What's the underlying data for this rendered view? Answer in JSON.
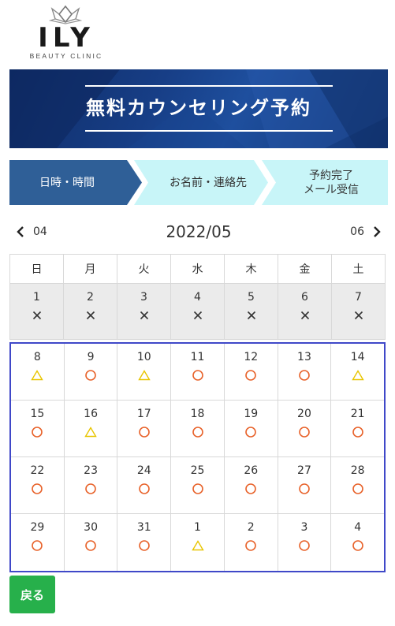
{
  "logo": {
    "brand": "ILY",
    "subtitle": "BEAUTY CLINIC"
  },
  "banner": {
    "title": "無料カウンセリング予約"
  },
  "steps": [
    {
      "label": "日時・時間",
      "active": true
    },
    {
      "label": "お名前・連絡先",
      "active": false
    },
    {
      "label_line1": "予約完了",
      "label_line2": "メール受信",
      "active": false
    }
  ],
  "month_nav": {
    "prev_label": "04",
    "current": "2022/05",
    "next_label": "06"
  },
  "calendar": {
    "weekdays": [
      "日",
      "月",
      "火",
      "水",
      "木",
      "金",
      "土"
    ],
    "weeks": [
      {
        "past": true,
        "days": [
          {
            "day": "1",
            "mark": "×"
          },
          {
            "day": "2",
            "mark": "×"
          },
          {
            "day": "3",
            "mark": "×"
          },
          {
            "day": "4",
            "mark": "×"
          },
          {
            "day": "5",
            "mark": "×"
          },
          {
            "day": "6",
            "mark": "×"
          },
          {
            "day": "7",
            "mark": "×"
          }
        ]
      },
      {
        "past": false,
        "days": [
          {
            "day": "8",
            "mark": "△"
          },
          {
            "day": "9",
            "mark": "○"
          },
          {
            "day": "10",
            "mark": "△"
          },
          {
            "day": "11",
            "mark": "○"
          },
          {
            "day": "12",
            "mark": "○"
          },
          {
            "day": "13",
            "mark": "○"
          },
          {
            "day": "14",
            "mark": "△"
          }
        ]
      },
      {
        "past": false,
        "days": [
          {
            "day": "15",
            "mark": "○"
          },
          {
            "day": "16",
            "mark": "△"
          },
          {
            "day": "17",
            "mark": "○"
          },
          {
            "day": "18",
            "mark": "○"
          },
          {
            "day": "19",
            "mark": "○"
          },
          {
            "day": "20",
            "mark": "○"
          },
          {
            "day": "21",
            "mark": "○"
          }
        ]
      },
      {
        "past": false,
        "days": [
          {
            "day": "22",
            "mark": "○"
          },
          {
            "day": "23",
            "mark": "○"
          },
          {
            "day": "24",
            "mark": "○"
          },
          {
            "day": "25",
            "mark": "○"
          },
          {
            "day": "26",
            "mark": "○"
          },
          {
            "day": "27",
            "mark": "○"
          },
          {
            "day": "28",
            "mark": "○"
          }
        ]
      },
      {
        "past": false,
        "days": [
          {
            "day": "29",
            "mark": "○"
          },
          {
            "day": "30",
            "mark": "○"
          },
          {
            "day": "31",
            "mark": "○"
          },
          {
            "day": "1",
            "mark": "△"
          },
          {
            "day": "2",
            "mark": "○"
          },
          {
            "day": "3",
            "mark": "○"
          },
          {
            "day": "4",
            "mark": "○"
          }
        ]
      }
    ]
  },
  "colors": {
    "available": "#e8622a",
    "few_left": "#e8c500",
    "unavailable": "#333333",
    "selection_border": "#3f48c8",
    "active_step": "#2f5f97",
    "inactive_step": "#c8f5f8",
    "back_button": "#27b04b"
  },
  "back_button": {
    "label": "戻る"
  }
}
